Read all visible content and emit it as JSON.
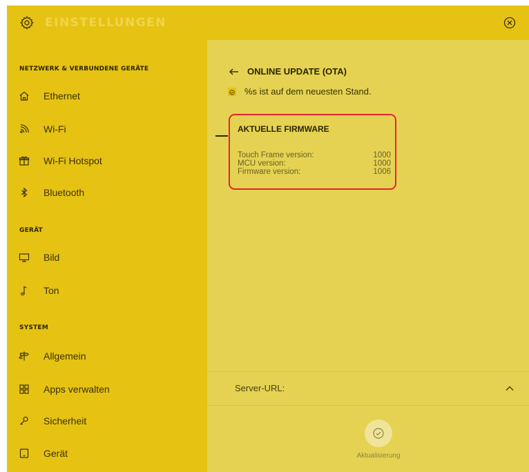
{
  "header": {
    "title": "EINSTELLUNGEN",
    "settings_icon": "gear-icon",
    "close_icon": "close-circle-icon"
  },
  "sidebar": {
    "sections": [
      {
        "title": "NETZWERK & VERBUNDENE GERÄTE",
        "items": [
          {
            "label": "Ethernet",
            "icon": "home-icon"
          },
          {
            "label": "Wi-Fi",
            "icon": "wifi-icon"
          },
          {
            "label": "Wi-Fi Hotspot",
            "icon": "gift-icon"
          },
          {
            "label": "Bluetooth",
            "icon": "bluetooth-icon"
          }
        ]
      },
      {
        "title": "GERÄT",
        "items": [
          {
            "label": "Bild",
            "icon": "monitor-icon"
          },
          {
            "label": "Ton",
            "icon": "music-note-icon"
          }
        ]
      },
      {
        "title": "SYSTEM",
        "items": [
          {
            "label": "Allgemein",
            "icon": "signpost-icon"
          },
          {
            "label": "Apps verwalten",
            "icon": "apps-grid-icon"
          },
          {
            "label": "Sicherheit",
            "icon": "key-icon"
          },
          {
            "label": "Gerät",
            "icon": "device-icon"
          }
        ]
      }
    ]
  },
  "main": {
    "back_label": "ONLINE UPDATE (OTA)",
    "status_text": "%s ist auf dem neuesten Stand.",
    "firmware": {
      "heading": "AKTUELLE FIRMWARE",
      "rows": [
        {
          "label": "Touch Frame version:",
          "value": "1000"
        },
        {
          "label": "MCU version:",
          "value": "1000"
        },
        {
          "label": "Firmware version:",
          "value": "1006"
        }
      ]
    },
    "server_url_label": "Server-URL:",
    "update_label": "Aktualisierung"
  },
  "colors": {
    "sidebar_bg": "#e6c213",
    "main_bg": "#e5d253",
    "highlight_border": "#e8232d",
    "text_dark": "#2c2600"
  }
}
